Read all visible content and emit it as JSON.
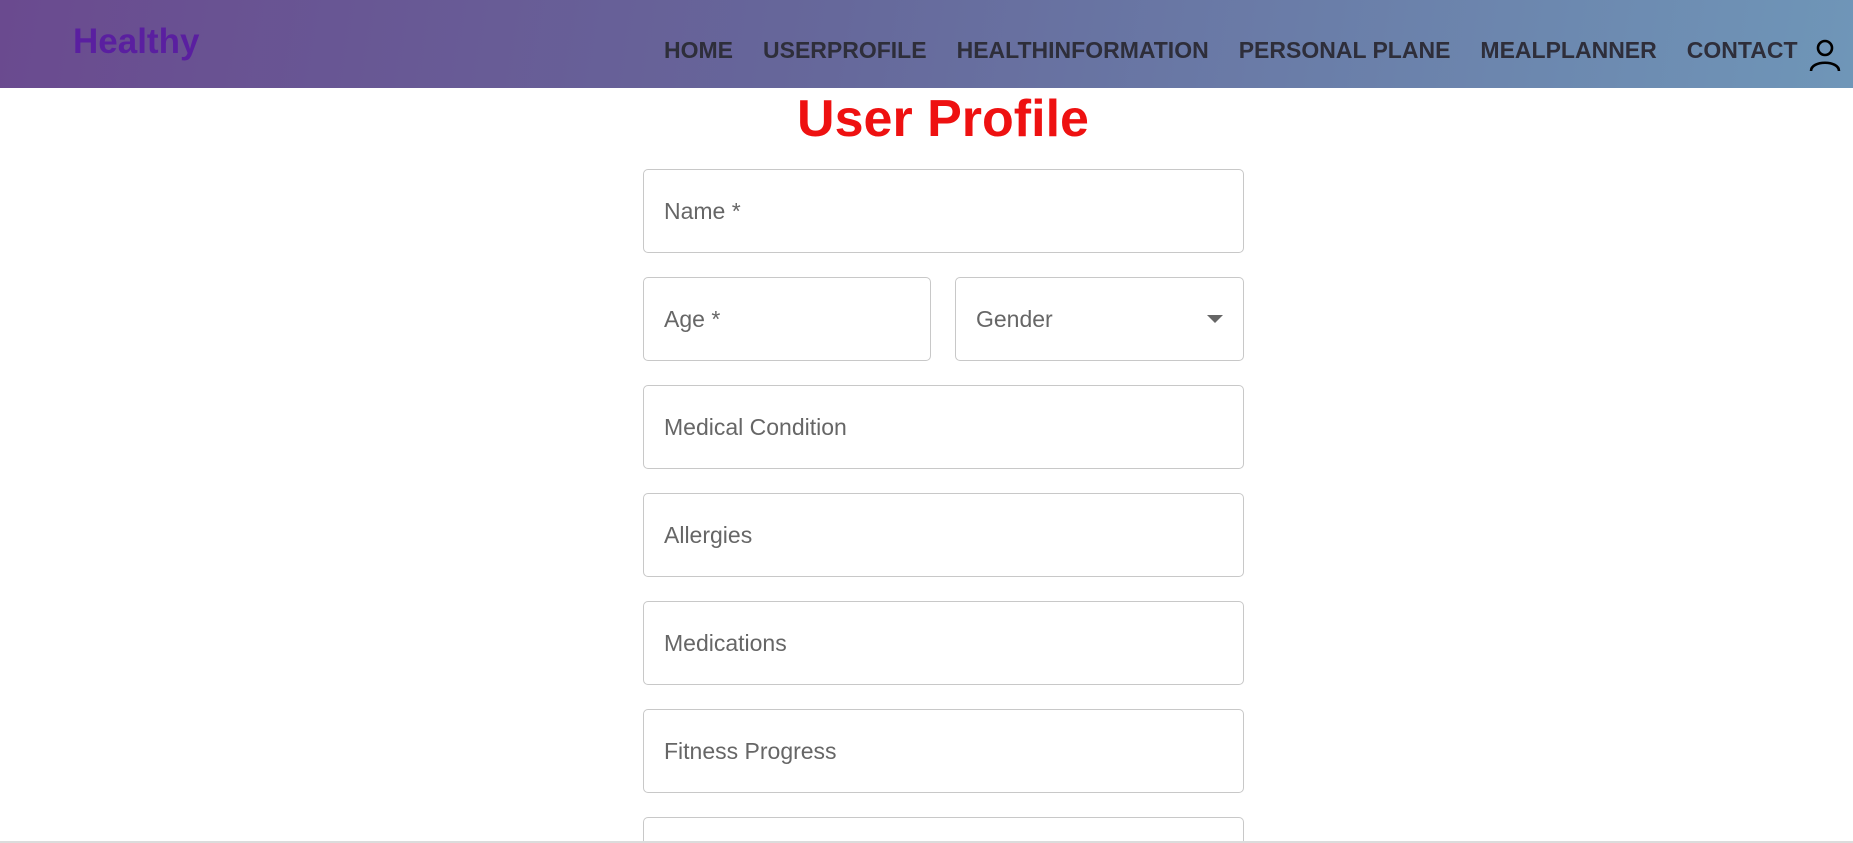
{
  "navbar": {
    "brand": "Healthy",
    "links": [
      {
        "label": "HOME"
      },
      {
        "label": "USERPROFILE"
      },
      {
        "label": "HEALTHINFORMATION"
      },
      {
        "label": "PERSONAL PLANE"
      },
      {
        "label": "MEALPLANNER"
      },
      {
        "label": "CONTACT"
      }
    ],
    "user_icon": "user-icon"
  },
  "page": {
    "title": "User Profile"
  },
  "form": {
    "name": {
      "placeholder": "Name *",
      "value": ""
    },
    "age": {
      "placeholder": "Age *",
      "value": ""
    },
    "gender": {
      "label": "Gender",
      "icon": "chevron-down-icon"
    },
    "medical_condition": {
      "placeholder": "Medical Condition",
      "value": ""
    },
    "allergies": {
      "placeholder": "Allergies",
      "value": ""
    },
    "medications": {
      "placeholder": "Medications",
      "value": ""
    },
    "fitness_progress": {
      "placeholder": "Fitness Progress",
      "value": ""
    }
  },
  "colors": {
    "title": "#ee1111",
    "brand": "#5a1fa0",
    "nav_gradient_start": "#6a4a8f",
    "nav_gradient_end": "#6f96b8"
  }
}
